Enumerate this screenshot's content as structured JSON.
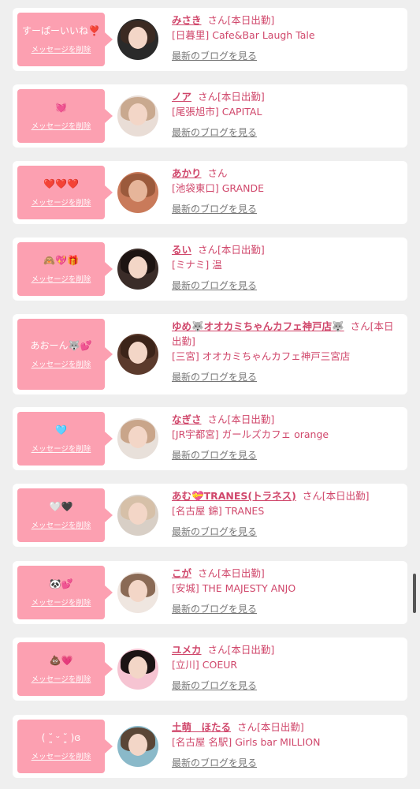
{
  "delete_label": "メッセージを削除",
  "blog_label": "最新のブログを見る",
  "san_label": "さん",
  "cards": [
    {
      "message": "すーぱーいいね❣️",
      "name": "みさき",
      "status": "[本日出勤]",
      "area": "[日暮里]",
      "shop": "Cafe&Bar Laugh Tale",
      "avatar_icon": "girl-photo-icon",
      "avatar_bg": "#2a2a2a",
      "hair": "#3b2a22"
    },
    {
      "message": "💓",
      "name": "ノア",
      "status": "[本日出勤]",
      "area": "[尾張旭市]",
      "shop": "CAPITAL",
      "avatar_icon": "heart-covered-photo-icon",
      "avatar_bg": "#e9ddd6",
      "hair": "#c9a98f"
    },
    {
      "message": "❤️❤️❤️",
      "name": "あかり",
      "status": "",
      "area": "[池袋東口]",
      "shop": "GRANDE",
      "avatar_icon": "pattern-photo-icon",
      "avatar_bg": "#c97a5a",
      "hair": "#9b5a3c"
    },
    {
      "message": "🙈💖🎁",
      "name": "るい",
      "status": "[本日出勤]",
      "area": "[ミナミ]",
      "shop": "温",
      "avatar_icon": "girl-photo-icon",
      "avatar_bg": "#3a2c28",
      "hair": "#1d1412"
    },
    {
      "message": "あおーん🐺💕",
      "name": "ゆめ🐺オオカミちゃんカフェ神戸店🐺",
      "status": "[本日出勤]",
      "area": "[三宮]",
      "shop": "オオカミちゃんカフェ神戸三宮店",
      "avatar_icon": "girl-photo-icon",
      "avatar_bg": "#5b3a2c",
      "hair": "#3c2419"
    },
    {
      "message": "🩵",
      "name": "なぎさ",
      "status": "[本日出勤]",
      "area": "[JR宇都宮]",
      "shop": "ガールズカフェ orange",
      "avatar_icon": "girl-photo-icon",
      "avatar_bg": "#e8e0da",
      "hair": "#c9a58a"
    },
    {
      "message": "🤍🖤",
      "name": "あむ💝TRANES(トラネス)",
      "status": "[本日出勤]",
      "area": "[名古屋 錦]",
      "shop": "TRANES",
      "avatar_icon": "girl-photo-icon",
      "avatar_bg": "#d8cfc6",
      "hair": "#d6c0a8"
    },
    {
      "message": "🐼💕",
      "name": "こが",
      "status": "[本日出勤]",
      "area": "[安城]",
      "shop": "THE MAJESTY ANJO",
      "avatar_icon": "girl-photo-icon",
      "avatar_bg": "#efe6e0",
      "hair": "#8a6a55"
    },
    {
      "message": "💩💗",
      "name": "ユメカ",
      "status": "[本日出勤]",
      "area": "[立川]",
      "shop": "COEUR",
      "avatar_icon": "girl-photo-icon",
      "avatar_bg": "#f6c4d2",
      "hair": "#1c1414"
    },
    {
      "message": "( ˘͈ ᵕ ˘͈ )ɞ",
      "name": "土萌　ほたる",
      "status": "[本日出勤]",
      "area": "[名古屋 名駅]",
      "shop": "Girls bar MILLION",
      "avatar_icon": "girl-photo-icon",
      "avatar_bg": "#8ab9c9",
      "hair": "#5a4636"
    }
  ]
}
